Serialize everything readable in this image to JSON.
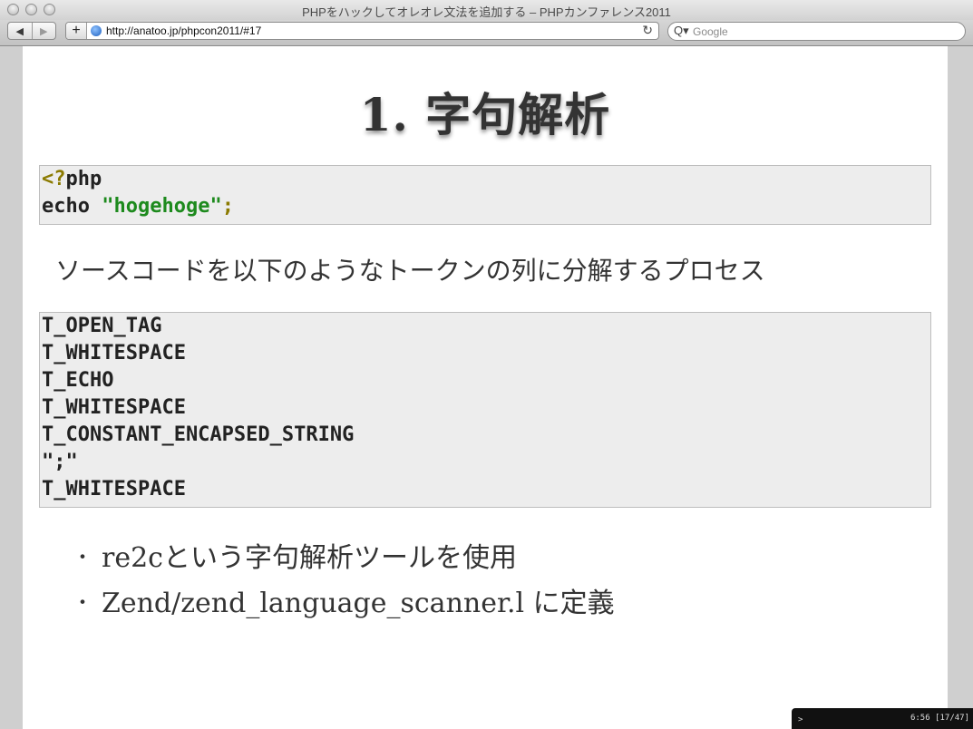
{
  "window": {
    "title": "PHPをハックしてオレオレ文法を追加する – PHPカンファレンス2011"
  },
  "toolbar": {
    "back_label": "◀",
    "forward_label": "▶",
    "add_label": "+",
    "url": "http://anatoo.jp/phpcon2011/#17",
    "reload_label": "↻",
    "search_placeholder": "Google",
    "search_icon_label": "Q▾"
  },
  "slide": {
    "title": "1. 字句解析",
    "code": {
      "line1_tag": "<?",
      "line1_rest": "php",
      "line2_kw": "echo ",
      "line2_str": "\"hogehoge\"",
      "line2_end": ";"
    },
    "description": "ソースコードを以下のようなトークンの列に分解するプロセス",
    "tokens": [
      "T_OPEN_TAG",
      "T_WHITESPACE",
      "T_ECHO",
      "T_WHITESPACE",
      "T_CONSTANT_ENCAPSED_STRING",
      "\";\"",
      "T_WHITESPACE"
    ],
    "bullets": [
      "re2cという字句解析ツールを使用",
      "Zend/zend_language_scanner.l に定義"
    ],
    "bullet_marker": "・"
  },
  "status": {
    "prompt": ">",
    "time": "6:56 [17/47]"
  }
}
